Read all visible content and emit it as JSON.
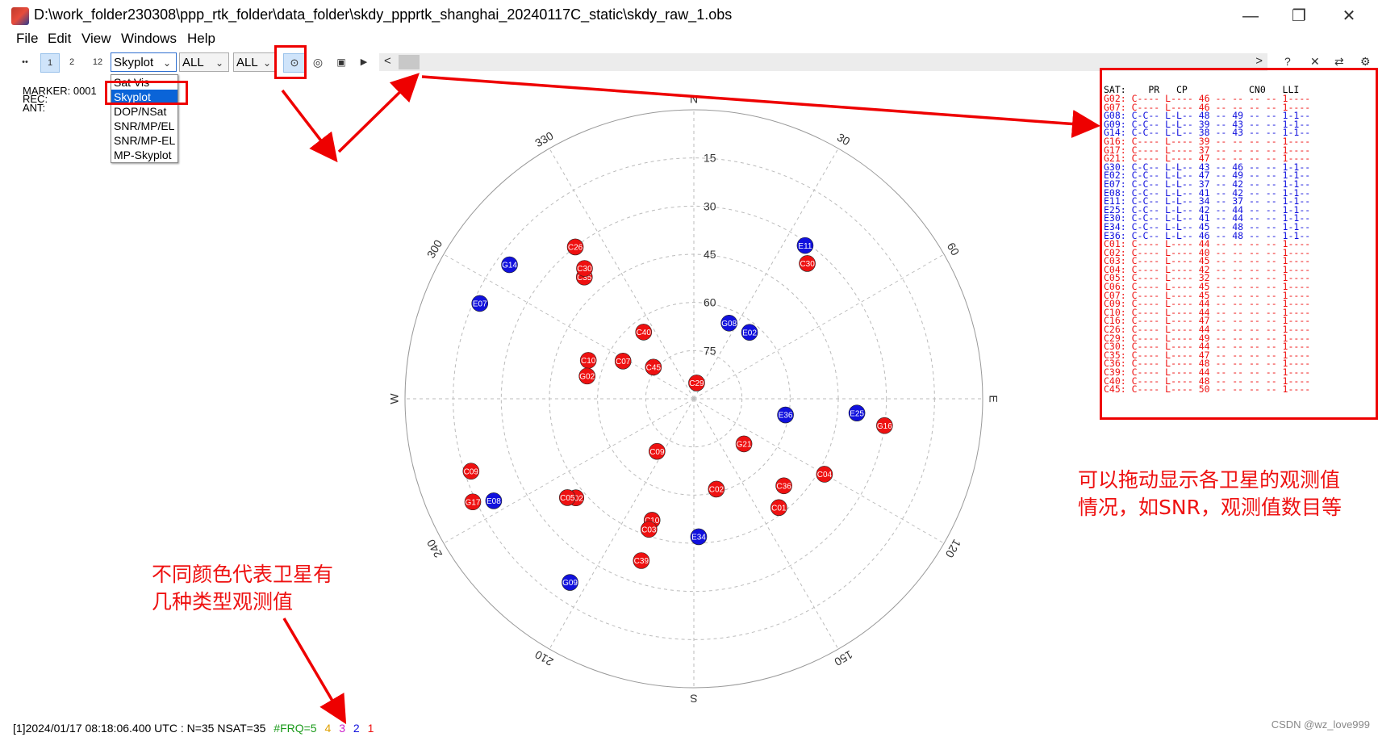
{
  "window": {
    "title": "D:\\work_folder230308\\ppp_rtk_folder\\data_folder\\skdy_ppprtk_shanghai_20240117C_static\\skdy_raw_1.obs",
    "minimize": "—",
    "maximize": "❐",
    "close": "✕"
  },
  "menu": [
    "File",
    "Edit",
    "View",
    "Windows",
    "Help"
  ],
  "toolbar": {
    "plot_type": "Skyplot",
    "sys_filter": "ALL",
    "freq_filter": "ALL",
    "btn_small": [
      "••",
      "1",
      "2",
      "12"
    ],
    "right_icons": [
      "?",
      "✕",
      "⇄",
      "⚙"
    ],
    "scroll_left": "<",
    "scroll_right": ">"
  },
  "dropdown_options": [
    "Sat Vis",
    "Skyplot",
    "DOP/NSat",
    "SNR/MP/EL",
    "SNR/MP-EL",
    "MP-Skyplot"
  ],
  "dropdown_selected": "Skyplot",
  "header_info": {
    "marker": "MARKER: 0001",
    "rec": "REC:",
    "ant": "ANT:"
  },
  "obs_table": {
    "header": "SAT:    PR   CP           CN0   LLI",
    "rows": [
      {
        "text": "G02: C---- L---- 46 -- -- -- -- 1----",
        "color": "red"
      },
      {
        "text": "G07: C---- L---- 46 -- -- -- -- 1----",
        "color": "red"
      },
      {
        "text": "G08: C-C-- L-L-- 48 -- 49 -- -- 1-1--",
        "color": "blue"
      },
      {
        "text": "G09: C-C-- L-L-- 39 -- 43 -- -- 1-1--",
        "color": "blue"
      },
      {
        "text": "G14: C-C-- L-L-- 38 -- 43 -- -- 1-1--",
        "color": "blue"
      },
      {
        "text": "G16: C---- L---- 39 -- -- -- -- 1----",
        "color": "red"
      },
      {
        "text": "G17: C---- L---- 37 -- -- -- -- 1----",
        "color": "red"
      },
      {
        "text": "G21: C---- L---- 47 -- -- -- -- 1----",
        "color": "red"
      },
      {
        "text": "G30: C-C-- L-L-- 43 -- 46 -- -- 1-1--",
        "color": "blue"
      },
      {
        "text": "E02: C-C-- L-L-- 47 -- 49 -- -- 1-1--",
        "color": "blue"
      },
      {
        "text": "E07: C-C-- L-L-- 37 -- 42 -- -- 1-1--",
        "color": "blue"
      },
      {
        "text": "E08: C-C-- L-L-- 41 -- 42 -- -- 1-1--",
        "color": "blue"
      },
      {
        "text": "E11: C-C-- L-L-- 34 -- 37 -- -- 1-1--",
        "color": "blue"
      },
      {
        "text": "E25: C-C-- L-L-- 42 -- 44 -- -- 1-1--",
        "color": "blue"
      },
      {
        "text": "E30: C-C-- L-L-- 41 -- 44 -- -- 1-1--",
        "color": "blue"
      },
      {
        "text": "E34: C-C-- L-L-- 45 -- 48 -- -- 1-1--",
        "color": "blue"
      },
      {
        "text": "E36: C-C-- L-L-- 46 -- 48 -- -- 1-1--",
        "color": "blue"
      },
      {
        "text": "C01: C---- L---- 44 -- -- -- -- 1----",
        "color": "red"
      },
      {
        "text": "C02: C---- L---- 40 -- -- -- -- 1----",
        "color": "red"
      },
      {
        "text": "C03: C---- L---- 45 -- -- -- -- 1----",
        "color": "red"
      },
      {
        "text": "C04: C---- L---- 42 -- -- -- -- 1----",
        "color": "red"
      },
      {
        "text": "C05: C---- L---- 32 -- -- -- -- 1----",
        "color": "red"
      },
      {
        "text": "C06: C---- L---- 45 -- -- -- -- 1----",
        "color": "red"
      },
      {
        "text": "C07: C---- L---- 45 -- -- -- -- 1----",
        "color": "red"
      },
      {
        "text": "C09: C---- L---- 44 -- -- -- -- 1----",
        "color": "red"
      },
      {
        "text": "C10: C---- L---- 44 -- -- -- -- 1----",
        "color": "red"
      },
      {
        "text": "C16: C---- L---- 47 -- -- -- -- 1----",
        "color": "red"
      },
      {
        "text": "C26: C---- L---- 44 -- -- -- -- 1----",
        "color": "red"
      },
      {
        "text": "C29: C---- L---- 49 -- -- -- -- 1----",
        "color": "red"
      },
      {
        "text": "C30: C---- L---- 44 -- -- -- -- 1----",
        "color": "red"
      },
      {
        "text": "C35: C---- L---- 47 -- -- -- -- 1----",
        "color": "red"
      },
      {
        "text": "C36: C---- L---- 48 -- -- -- -- 1----",
        "color": "red"
      },
      {
        "text": "C39: C---- L---- 44 -- -- -- -- 1----",
        "color": "red"
      },
      {
        "text": "C40: C---- L---- 48 -- -- -- -- 1----",
        "color": "red"
      },
      {
        "text": "C45: C---- L---- 50 -- -- -- -- 1----",
        "color": "red"
      }
    ]
  },
  "skyplot": {
    "elevation_labels": [
      "15",
      "30",
      "45",
      "60",
      "75"
    ],
    "azimuth_labels": {
      "0": "N",
      "30": "30",
      "60": "60",
      "90": "E",
      "120": "120",
      "150": "150",
      "180": "S",
      "210": "210",
      "240": "240",
      "270": "W",
      "300": "300",
      "330": "330"
    },
    "colors": {
      "red": "#ee1111",
      "blue": "#1111dd",
      "grid": "#bbbbbb"
    },
    "satellites": [
      {
        "id": "E11",
        "az": 36,
        "el": 31,
        "color": "blue"
      },
      {
        "id": "C30",
        "az": 40,
        "el": 35,
        "color": "red"
      },
      {
        "id": "C26",
        "az": -38,
        "el": 30,
        "color": "red"
      },
      {
        "id": "C35",
        "az": -42,
        "el": 39,
        "color": "red"
      },
      {
        "id": "C30",
        "az": -40,
        "el": 37,
        "color": "red"
      },
      {
        "id": "G14",
        "az": -54,
        "el": 19,
        "color": "blue"
      },
      {
        "id": "E07",
        "az": -66,
        "el": 17,
        "color": "blue"
      },
      {
        "id": "G08",
        "az": 25,
        "el": 64,
        "color": "blue"
      },
      {
        "id": "E02",
        "az": 40,
        "el": 63,
        "color": "blue"
      },
      {
        "id": "C40",
        "az": -37,
        "el": 64,
        "color": "red"
      },
      {
        "id": "C07",
        "az": -62,
        "el": 65,
        "color": "red"
      },
      {
        "id": "C10",
        "az": -70,
        "el": 55,
        "color": "red"
      },
      {
        "id": "G02",
        "az": -78,
        "el": 56,
        "color": "red"
      },
      {
        "id": "C45",
        "az": -52,
        "el": 74,
        "color": "red"
      },
      {
        "id": "C29",
        "az": 10,
        "el": 85,
        "color": "red"
      },
      {
        "id": "E36",
        "az": 100,
        "el": 61,
        "color": "blue"
      },
      {
        "id": "E25",
        "az": 95,
        "el": 39,
        "color": "blue"
      },
      {
        "id": "G16",
        "az": 98,
        "el": 30,
        "color": "red"
      },
      {
        "id": "G21",
        "az": 132,
        "el": 69,
        "color": "red"
      },
      {
        "id": "C09",
        "az": -145,
        "el": 70,
        "color": "red"
      },
      {
        "id": "C02",
        "az": 166,
        "el": 61,
        "color": "red"
      },
      {
        "id": "C36",
        "az": 134,
        "el": 51,
        "color": "red"
      },
      {
        "id": "C01",
        "az": 142,
        "el": 47,
        "color": "red"
      },
      {
        "id": "C04",
        "az": 120,
        "el": 43,
        "color": "red"
      },
      {
        "id": "C02",
        "az": -130,
        "el": 42,
        "color": "red"
      },
      {
        "id": "C05",
        "az": -128,
        "el": 40,
        "color": "red"
      },
      {
        "id": "C10",
        "az": -161,
        "el": 50,
        "color": "red"
      },
      {
        "id": "C03",
        "az": -161,
        "el": 47,
        "color": "red"
      },
      {
        "id": "C39",
        "az": -162,
        "el": 37,
        "color": "red"
      },
      {
        "id": "E34",
        "az": 178,
        "el": 47,
        "color": "blue"
      },
      {
        "id": "G09",
        "az": -146,
        "el": 21,
        "color": "blue"
      },
      {
        "id": "C09",
        "az": -108,
        "el": 17,
        "color": "red"
      },
      {
        "id": "G17",
        "az": -115,
        "el": 14,
        "color": "red"
      },
      {
        "id": "E08",
        "az": -117,
        "el": 20,
        "color": "blue"
      }
    ]
  },
  "annotations": {
    "right_text": [
      "可以拖动显示各卫星的观测值",
      "情况，如SNR，观测值数目等"
    ],
    "left_text": [
      "不同颜色代表卫星有",
      "几种类型观测值"
    ]
  },
  "status": {
    "main": "[1]2024/01/17 08:18:06.400 UTC : N=35 NSAT=35",
    "frq_label": "#FRQ=5",
    "frq_counts": [
      {
        "v": "4",
        "c": "#e0a000"
      },
      {
        "v": "3",
        "c": "#cc22cc"
      },
      {
        "v": "2",
        "c": "#1111dd"
      },
      {
        "v": "1",
        "c": "#ee1111"
      }
    ],
    "frq_label_color": "#1a9a1a"
  },
  "watermark": "CSDN @wz_love999"
}
